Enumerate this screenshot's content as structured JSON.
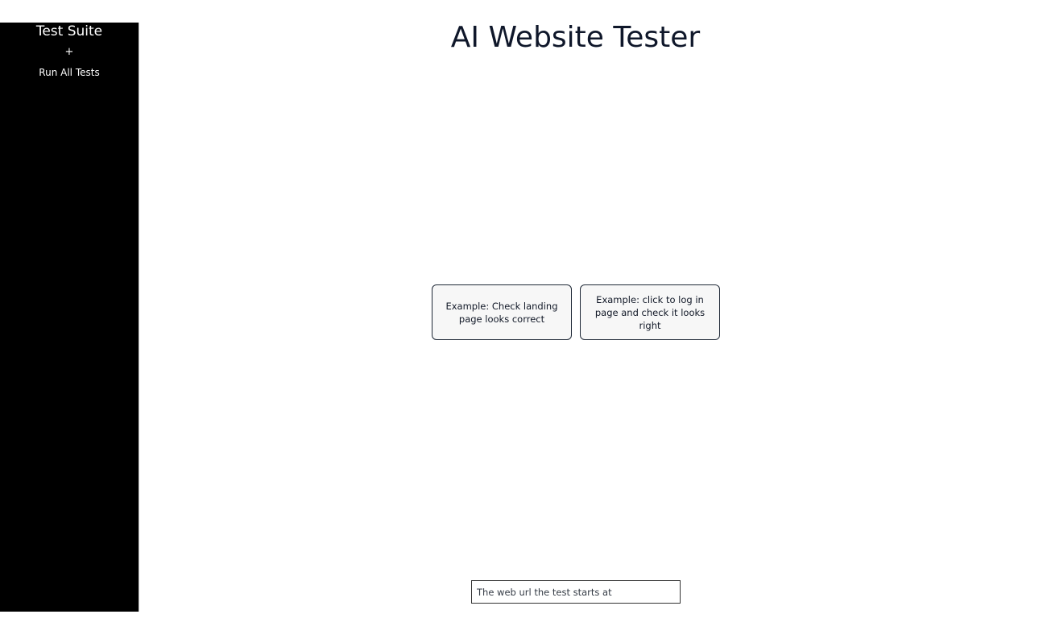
{
  "sidebar": {
    "title": "Test Suite",
    "add_label": "+",
    "run_all_label": "Run All Tests"
  },
  "main": {
    "title": "AI Website Tester",
    "examples": [
      {
        "label": "Example: Check landing page looks correct"
      },
      {
        "label": "Example: click to log in page and check it looks right"
      }
    ],
    "url_input": {
      "value": "",
      "placeholder": "The web url the test starts at"
    }
  },
  "colors": {
    "sidebar_bg": "#000000",
    "card_bg": "#f7f7f7",
    "title_text": "#0f172a"
  }
}
